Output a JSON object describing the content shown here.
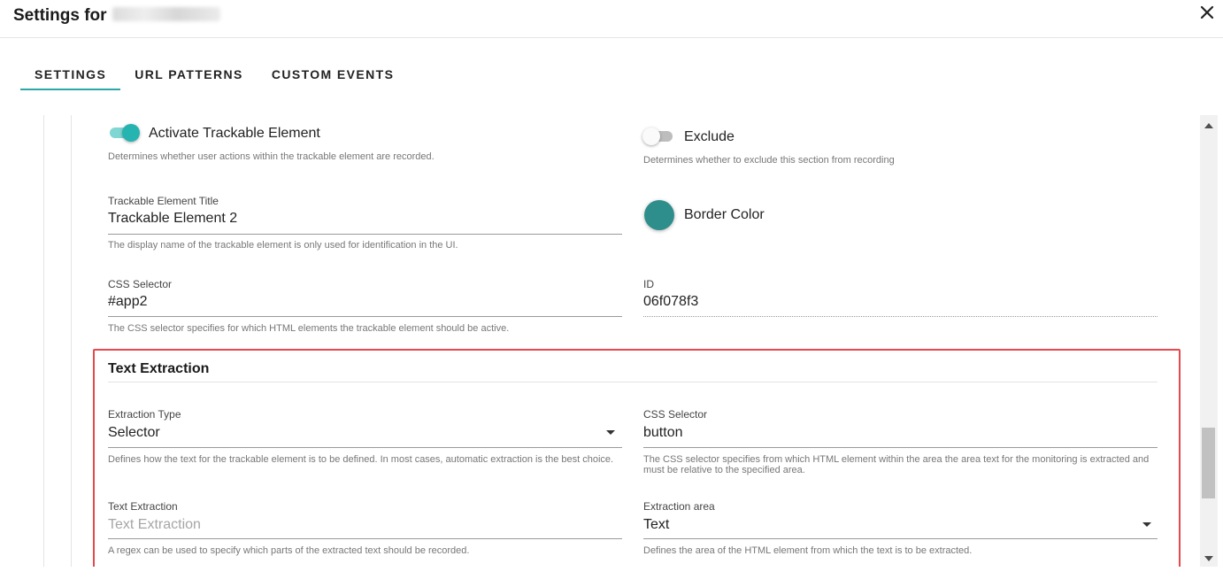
{
  "dialog": {
    "title": "Settings for"
  },
  "tabs": [
    {
      "label": "SETTINGS",
      "active": true
    },
    {
      "label": "URL PATTERNS",
      "active": false
    },
    {
      "label": "CUSTOM EVENTS",
      "active": false
    }
  ],
  "form": {
    "activate": {
      "label": "Activate Trackable Element",
      "help": "Determines whether user actions within the trackable element are recorded.",
      "on": true
    },
    "exclude": {
      "label": "Exclude",
      "help": "Determines whether to exclude this section from recording",
      "on": false
    },
    "title_field": {
      "label": "Trackable Element Title",
      "value": "Trackable Element 2",
      "help": "The display name of the trackable element is only used for identification in the UI."
    },
    "border_color": {
      "label": "Border Color",
      "color": "#2e8e8b"
    },
    "css_selector": {
      "label": "CSS Selector",
      "value": "#app2",
      "help": "The CSS selector specifies for which HTML elements the trackable element should be active."
    },
    "id_field": {
      "label": "ID",
      "value": "06f078f3"
    }
  },
  "text_extraction": {
    "heading": "Text Extraction",
    "extraction_type": {
      "label": "Extraction Type",
      "value": "Selector",
      "help": "Defines how the text for the trackable element is to be defined. In most cases, automatic extraction is the best choice."
    },
    "css_selector": {
      "label": "CSS Selector",
      "value": "button",
      "help": "The CSS selector specifies from which HTML element within the area the area text for the monitoring is extracted and must be relative to the specified area."
    },
    "text_extraction": {
      "label": "Text Extraction",
      "placeholder": "Text Extraction",
      "help": "A regex can be used to specify which parts of the extracted text should be recorded."
    },
    "extraction_area": {
      "label": "Extraction area",
      "value": "Text",
      "help": "Defines the area of the HTML element from which the text is to be extracted."
    }
  },
  "colors": {
    "accent": "#2ba7a6",
    "toggle_on_track": "#7fd6d3",
    "toggle_on_knob": "#26b4b0",
    "highlight": "#e5484d"
  }
}
